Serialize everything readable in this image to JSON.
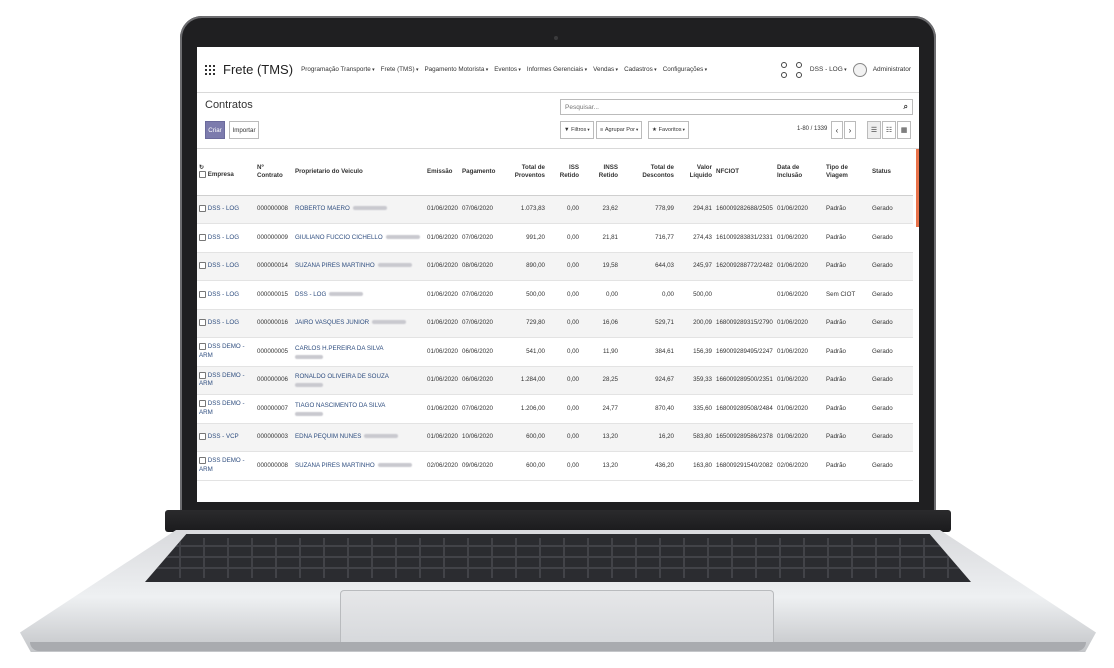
{
  "navbar": {
    "brand": "Frete (TMS)",
    "menu": [
      "Programação Transporte",
      "Frete (TMS)",
      "Pagamento Motorista",
      "Eventos",
      "Informes Gerenciais",
      "Vendas",
      "Cadastros",
      "Configurações"
    ],
    "company": "DSS - LOG",
    "user": "Administrator"
  },
  "control_panel": {
    "title": "Contratos",
    "create_label": "Criar",
    "import_label": "Importar",
    "search_placeholder": "Pesquisar...",
    "filters_label": "Filtros",
    "group_by_label": "Agrupar Por",
    "favorites_label": "Favoritos",
    "pager": "1-80 / 1339"
  },
  "table": {
    "headers": {
      "empresa": "Empresa",
      "contrato": "Nº Contrato",
      "proprietario": "Proprietario do Veiculo",
      "emissao": "Emissão",
      "pagamento": "Pagamento",
      "total_proventos": "Total de Proventos",
      "iss": "ISS Retido",
      "inss": "INSS Retido",
      "total_descontos": "Total de Descontos",
      "valor_liquido": "Valor Líquido",
      "nfciot": "NFCIOT",
      "data_inclusao": "Data de Inclusão",
      "tipo_viagem": "Tipo de Viagem",
      "status": "Status"
    },
    "rows": [
      {
        "empresa": "DSS - LOG",
        "contrato": "000000008",
        "proprietario": "ROBERTO MAERO",
        "emissao": "01/06/2020",
        "pagamento": "07/06/2020",
        "total_proventos": "1.073,83",
        "iss": "0,00",
        "inss": "23,62",
        "total_descontos": "778,99",
        "valor_liquido": "294,81",
        "nfciot": "160009282688/2505",
        "data_inclusao": "01/06/2020",
        "tipo_viagem": "Padrão",
        "status": "Gerado"
      },
      {
        "empresa": "DSS - LOG",
        "contrato": "000000009",
        "proprietario": "GIULIANO FUCCIO CICHELLO",
        "emissao": "01/06/2020",
        "pagamento": "07/06/2020",
        "total_proventos": "991,20",
        "iss": "0,00",
        "inss": "21,81",
        "total_descontos": "716,77",
        "valor_liquido": "274,43",
        "nfciot": "161009283831/2331",
        "data_inclusao": "01/06/2020",
        "tipo_viagem": "Padrão",
        "status": "Gerado"
      },
      {
        "empresa": "DSS - LOG",
        "contrato": "000000014",
        "proprietario": "SUZANA PIRES MARTINHO",
        "emissao": "01/06/2020",
        "pagamento": "08/06/2020",
        "total_proventos": "890,00",
        "iss": "0,00",
        "inss": "19,58",
        "total_descontos": "644,03",
        "valor_liquido": "245,97",
        "nfciot": "162009288772/2482",
        "data_inclusao": "01/06/2020",
        "tipo_viagem": "Padrão",
        "status": "Gerado"
      },
      {
        "empresa": "DSS - LOG",
        "contrato": "000000015",
        "proprietario": "DSS - LOG",
        "emissao": "01/06/2020",
        "pagamento": "07/06/2020",
        "total_proventos": "500,00",
        "iss": "0,00",
        "inss": "0,00",
        "total_descontos": "0,00",
        "valor_liquido": "500,00",
        "nfciot": "",
        "data_inclusao": "01/06/2020",
        "tipo_viagem": "Sem CIOT",
        "status": "Gerado"
      },
      {
        "empresa": "DSS - LOG",
        "contrato": "000000016",
        "proprietario": "JAIRO VASQUES JUNIOR",
        "emissao": "01/06/2020",
        "pagamento": "07/06/2020",
        "total_proventos": "729,80",
        "iss": "0,00",
        "inss": "16,06",
        "total_descontos": "529,71",
        "valor_liquido": "200,09",
        "nfciot": "168009289315/2790",
        "data_inclusao": "01/06/2020",
        "tipo_viagem": "Padrão",
        "status": "Gerado"
      },
      {
        "empresa": "DSS DEMO - ARM",
        "contrato": "000000005",
        "proprietario": "CARLOS H.PEREIRA DA SILVA",
        "emissao": "01/06/2020",
        "pagamento": "06/06/2020",
        "total_proventos": "541,00",
        "iss": "0,00",
        "inss": "11,90",
        "total_descontos": "384,61",
        "valor_liquido": "156,39",
        "nfciot": "169009289495/2247",
        "data_inclusao": "01/06/2020",
        "tipo_viagem": "Padrão",
        "status": "Gerado"
      },
      {
        "empresa": "DSS DEMO - ARM",
        "contrato": "000000006",
        "proprietario": "RONALDO OLIVEIRA DE SOUZA",
        "emissao": "01/06/2020",
        "pagamento": "06/06/2020",
        "total_proventos": "1.284,00",
        "iss": "0,00",
        "inss": "28,25",
        "total_descontos": "924,67",
        "valor_liquido": "359,33",
        "nfciot": "166009289500/2351",
        "data_inclusao": "01/06/2020",
        "tipo_viagem": "Padrão",
        "status": "Gerado"
      },
      {
        "empresa": "DSS DEMO - ARM",
        "contrato": "000000007",
        "proprietario": "TIAGO NASCIMENTO DA SILVA",
        "emissao": "01/06/2020",
        "pagamento": "07/06/2020",
        "total_proventos": "1.206,00",
        "iss": "0,00",
        "inss": "24,77",
        "total_descontos": "870,40",
        "valor_liquido": "335,60",
        "nfciot": "168009289508/2484",
        "data_inclusao": "01/06/2020",
        "tipo_viagem": "Padrão",
        "status": "Gerado"
      },
      {
        "empresa": "DSS - VCP",
        "contrato": "000000003",
        "proprietario": "EDNA PEQUIM NUNES",
        "emissao": "01/06/2020",
        "pagamento": "10/06/2020",
        "total_proventos": "600,00",
        "iss": "0,00",
        "inss": "13,20",
        "total_descontos": "16,20",
        "valor_liquido": "583,80",
        "nfciot": "165009289586/2378",
        "data_inclusao": "01/06/2020",
        "tipo_viagem": "Padrão",
        "status": "Gerado"
      },
      {
        "empresa": "DSS DEMO - ARM",
        "contrato": "000000008",
        "proprietario": "SUZANA PIRES MARTINHO",
        "emissao": "02/06/2020",
        "pagamento": "09/06/2020",
        "total_proventos": "600,00",
        "iss": "0,00",
        "inss": "13,20",
        "total_descontos": "436,20",
        "valor_liquido": "163,80",
        "nfciot": "168009291540/2082",
        "data_inclusao": "02/06/2020",
        "tipo_viagem": "Padrão",
        "status": "Gerado"
      }
    ]
  },
  "colors": {
    "primary_button": "#7c7bad",
    "link": "#2e4d7f",
    "scroll_accent": "#e8724a"
  }
}
